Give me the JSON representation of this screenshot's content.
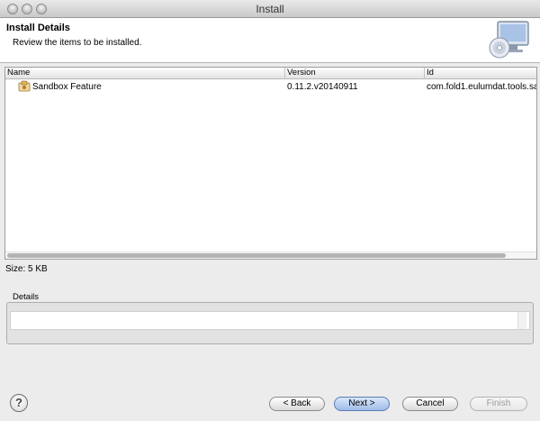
{
  "window": {
    "title": "Install"
  },
  "banner": {
    "title": "Install Details",
    "subtitle": "Review the items to be installed."
  },
  "table": {
    "columns": [
      "Name",
      "Version",
      "Id"
    ],
    "rows": [
      {
        "name": "Sandbox Feature",
        "version": "0.11.2.v20140911",
        "id": "com.fold1.eulumdat.tools.san"
      }
    ]
  },
  "size_label": "Size: 5 KB",
  "details": {
    "label": "Details"
  },
  "buttons": {
    "back": "< Back",
    "next": "Next >",
    "cancel": "Cancel",
    "finish": "Finish",
    "help": "?"
  },
  "icons": {
    "banner": "install-wizard-icon",
    "feature": "feature-plugin-icon"
  },
  "colors": {
    "accent": "#9fbce8"
  }
}
